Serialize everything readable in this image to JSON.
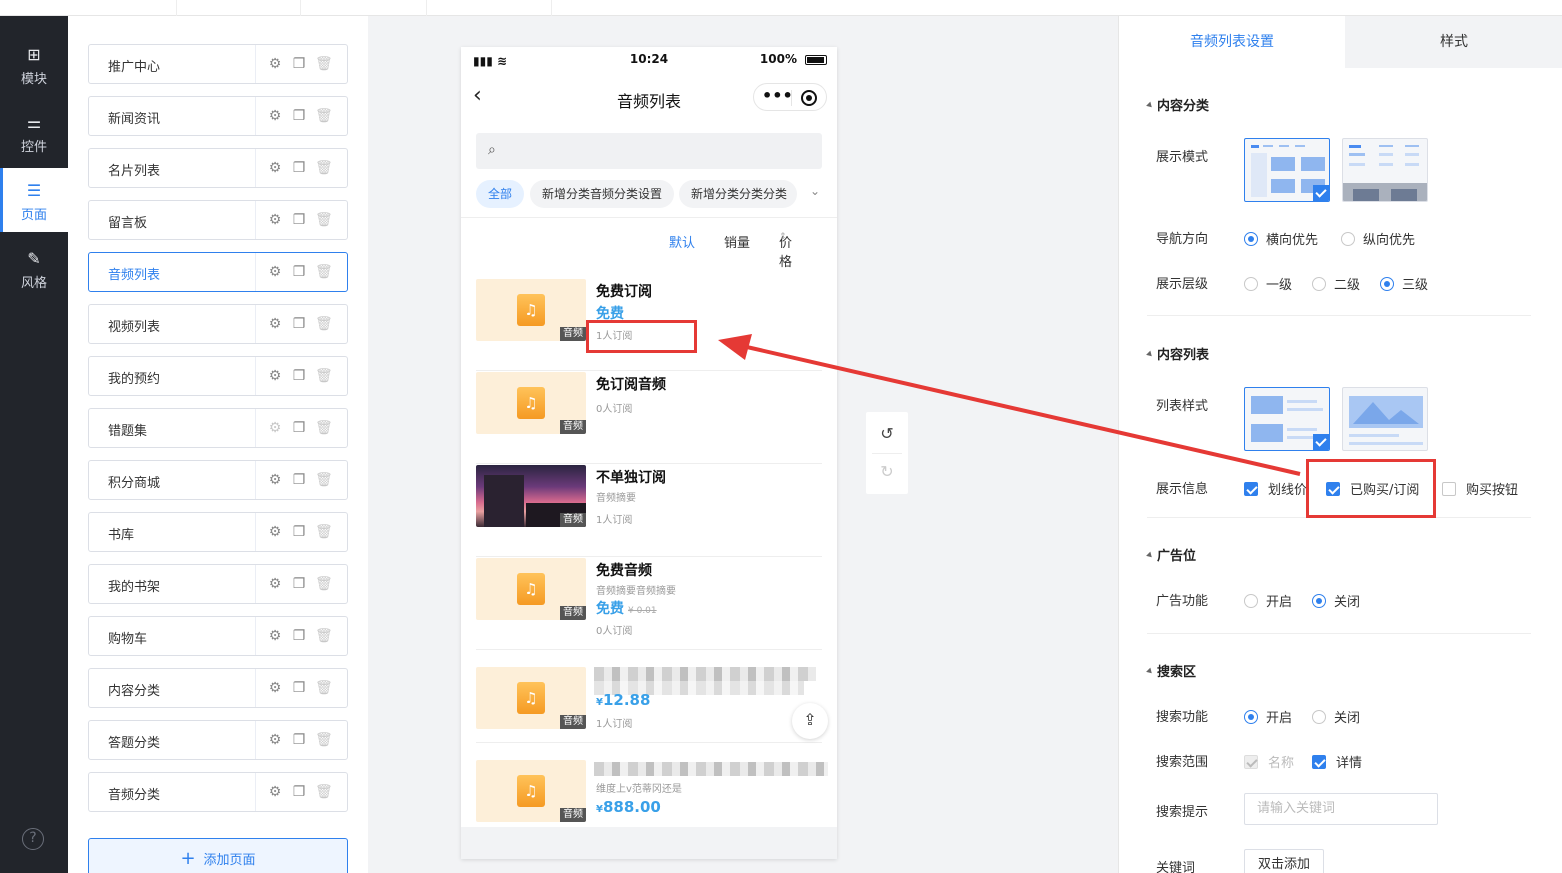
{
  "leftnav": {
    "items": [
      {
        "icon": "plus-square-icon",
        "label": "模块"
      },
      {
        "icon": "sliders-icon",
        "label": "控件"
      },
      {
        "icon": "pages-icon",
        "label": "页面"
      },
      {
        "icon": "magic-wand-icon",
        "label": "风格"
      }
    ],
    "help": "?"
  },
  "pagelist": {
    "items": [
      "推广中心",
      "新闻资讯",
      "名片列表",
      "留言板",
      "音频列表",
      "视频列表",
      "我的预约",
      "错题集",
      "积分商城",
      "书库",
      "我的书架",
      "购物车",
      "内容分类",
      "答题分类",
      "音频分类"
    ],
    "selected": "音频列表",
    "add_label": "添加页面"
  },
  "phone": {
    "status": {
      "time": "10:24",
      "battery": "100%"
    },
    "title": "音频列表",
    "tabs": [
      "全部",
      "新增分类音频分类设置",
      "新增分类分类分类"
    ],
    "sort": {
      "default": "默认",
      "sales": "销量",
      "price": "价格"
    },
    "tag": "音频",
    "items": [
      {
        "title": "免费订阅",
        "free": "免费",
        "subs": "1人订阅"
      },
      {
        "title": "免订阅音频",
        "subs": "0人订阅"
      },
      {
        "title": "不单独订阅",
        "summary": "音频摘要",
        "subs": "1人订阅"
      },
      {
        "title": "免费音频",
        "summary": "音频摘要音频摘要",
        "free": "免费",
        "old_price": "¥ 0.01",
        "subs": "0人订阅"
      },
      {
        "currency": "¥",
        "price": "12.88",
        "subs": "1人订阅"
      },
      {
        "summary": "维度上v范蒂冈还是",
        "currency": "¥",
        "price": "888.00"
      }
    ]
  },
  "settings": {
    "tabs": {
      "active": "音频列表设置",
      "other": "样式"
    },
    "content_category": {
      "title": "内容分类",
      "display_mode": "展示模式",
      "nav_direction": {
        "label": "导航方向",
        "options": [
          "横向优先",
          "纵向优先"
        ],
        "selected": "横向优先"
      },
      "levels": {
        "label": "展示层级",
        "options": [
          "一级",
          "二级",
          "三级"
        ],
        "selected": "三级"
      }
    },
    "content_list": {
      "title": "内容列表",
      "list_style": "列表样式",
      "display_info": {
        "label": "展示信息",
        "options": [
          "划线价",
          "已购买/订阅",
          "购买按钮"
        ],
        "checked": [
          "划线价",
          "已购买/订阅"
        ]
      }
    },
    "ad": {
      "title": "广告位",
      "label": "广告功能",
      "options": [
        "开启",
        "关闭"
      ],
      "selected": "关闭"
    },
    "search": {
      "title": "搜索区",
      "func": {
        "label": "搜索功能",
        "options": [
          "开启",
          "关闭"
        ],
        "selected": "开启"
      },
      "range": {
        "label": "搜索范围",
        "options": [
          "名称",
          "详情"
        ]
      },
      "hint": {
        "label": "搜索提示",
        "placeholder": "请输入关键词"
      },
      "keyword": {
        "label": "关键词",
        "button": "双击添加"
      }
    }
  },
  "colors": {
    "accent": "#2f80ed",
    "highlight": "#e53935",
    "price": "#39a0e8"
  }
}
